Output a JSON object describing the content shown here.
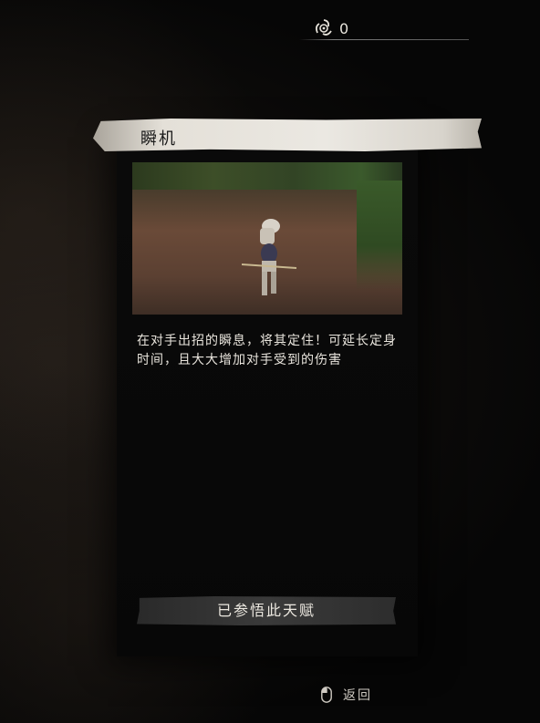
{
  "currency": {
    "icon": "spiral-emblem-icon",
    "value": "0"
  },
  "talent": {
    "title": "瞬机",
    "preview_image": "two-swordsmen-dueling-screenshot",
    "description": "在对手出招的瞬息，将其定住！可延长定身时间，且大大增加对手受到的伤害",
    "status_button": "已参悟此天赋"
  },
  "footer": {
    "back_icon": "mouse-icon",
    "back_label": "返回"
  },
  "colors": {
    "title_bar": "#e4e0d8",
    "panel": "#0a0a0a",
    "button": "#3a3a3a"
  }
}
